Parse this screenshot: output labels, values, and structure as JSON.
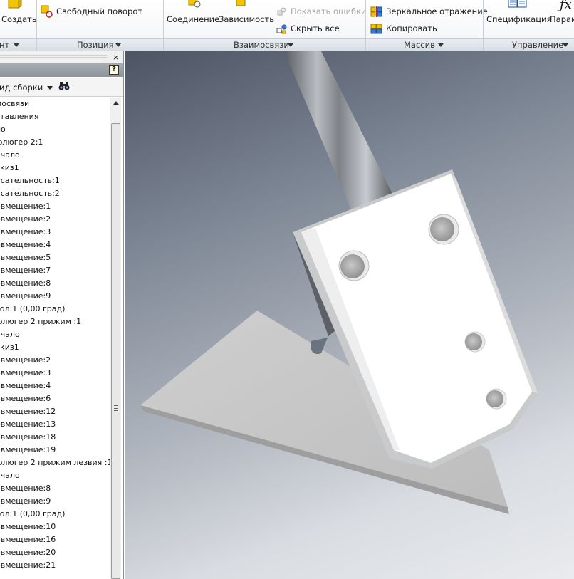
{
  "ribbon": {
    "create_label": "Создать",
    "free_rotate_label": "Свободный поворот",
    "joint_label": "Соединение",
    "constraint_label": "Зависимость",
    "show_errors_label": "Показать ошибки",
    "hide_all_label": "Скрыть все",
    "mirror_label": "Зеркальное отражение",
    "copy_label": "Копировать",
    "bom_label": "Спецификация",
    "params_label": "Парам",
    "panels": {
      "component": "нт",
      "position": "Позиция",
      "relationships": "Взаимосвязи",
      "pattern": "Массив",
      "manage": "Управление"
    }
  },
  "browser": {
    "view_label": "ид сборки",
    "help_glyph": "?",
    "close_glyph": "×",
    "tree": [
      "мосвязи",
      "ставления",
      "ло",
      "флюгер 2:1",
      "ачало",
      "скиз1",
      "асательность:1",
      "асательность:2",
      "овмещение:1",
      "овмещение:2",
      "овмещение:3",
      "овмещение:4",
      "овмещение:5",
      "овмещение:7",
      "овмещение:8",
      "овмещение:9",
      "гол:1 (0,00 град)",
      "флюгер 2 прижим :1",
      "ачало",
      "скиз1",
      "овмещение:2",
      "овмещение:3",
      "овмещение:4",
      "овмещение:6",
      "овмещение:12",
      "овмещение:13",
      "овмещение:18",
      "овмещение:19",
      "флюгер 2 прижим лезвия :1",
      "ачало",
      "овмещение:8",
      "овмещение:9",
      "гол:1 (0,00 град)",
      "овмещение:10",
      "овмещение:16",
      "овмещение:20",
      "овмещение:21"
    ]
  },
  "colors": {
    "accent_blue": "#2a6fd0",
    "panel_bar": "#d7dde5",
    "browser_title": "#8c939b"
  }
}
